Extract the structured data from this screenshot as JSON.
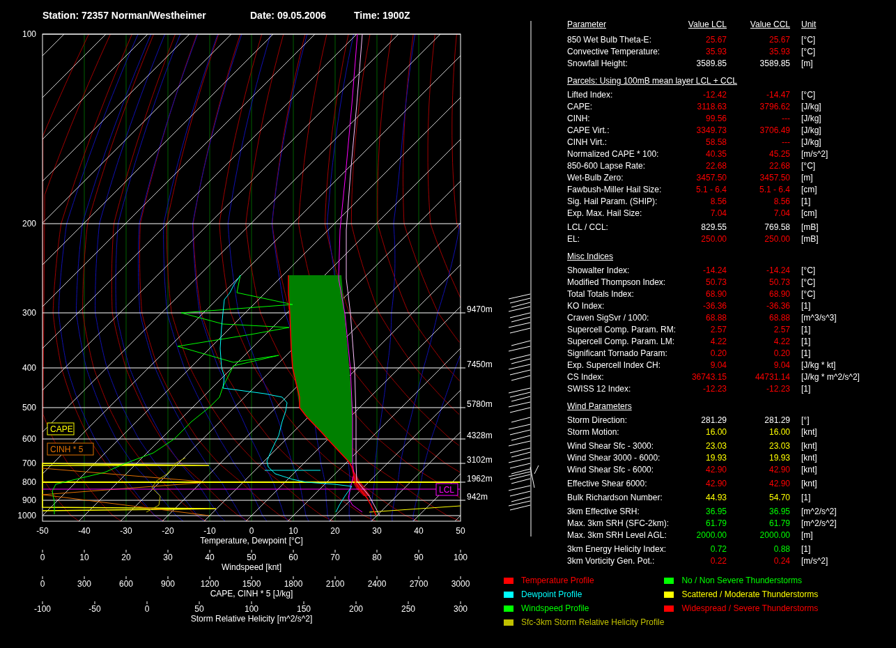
{
  "title": {
    "station": "Station: 72357 Norman/Westheimer",
    "date": "Date: 09.05.2006",
    "time": "Time: 1900Z"
  },
  "diagram": {
    "pressure_levels": [
      {
        "label": "100"
      },
      {
        "label": "200"
      },
      {
        "label": "300",
        "height": "9470m"
      },
      {
        "label": "400",
        "height": "7450m"
      },
      {
        "label": "500",
        "height": "5780m"
      },
      {
        "label": "600",
        "height": "4328m"
      },
      {
        "label": "700",
        "height": "3102m"
      },
      {
        "label": "800",
        "height": "1962m"
      },
      {
        "label": "900",
        "height": "942m"
      },
      {
        "label": "1000"
      }
    ],
    "markers": [
      {
        "kind": "cape",
        "label": "CAPE"
      },
      {
        "kind": "cinh",
        "label": "CINH * 5"
      },
      {
        "kind": "lcl",
        "label": "LCL"
      }
    ],
    "axes": [
      {
        "title": "Temperature, Dewpoint [°C]",
        "ticks": [
          "-50",
          "-40",
          "-30",
          "-20",
          "-10",
          "0",
          "10",
          "20",
          "30",
          "40",
          "50"
        ]
      },
      {
        "title": "Windspeed [knt]",
        "ticks": [
          "0",
          "10",
          "20",
          "30",
          "40",
          "50",
          "60",
          "70",
          "80",
          "90",
          "100"
        ]
      },
      {
        "title": "CAPE, CINH * 5 [J/kg]",
        "ticks": [
          "0",
          "300",
          "600",
          "900",
          "1200",
          "1500",
          "1800",
          "2100",
          "2400",
          "2700",
          "3000"
        ]
      },
      {
        "title": "Storm Relative Helicity [m^2/s^2]",
        "ticks": [
          "-100",
          "-50",
          "0",
          "50",
          "100",
          "150",
          "200",
          "250",
          "300"
        ]
      }
    ]
  },
  "table": {
    "header": [
      "Parameter",
      "Value LCL",
      "Value CCL",
      "Unit"
    ],
    "sections": [
      {
        "groups": [
          [
            {
              "label": "850 Wet Bulb Theta-E:",
              "lcl": "25.67",
              "ccl": "25.67",
              "unit": "[°C]",
              "color": "#ff0000"
            },
            {
              "label": "Convective Temperature:",
              "lcl": "35.93",
              "ccl": "35.93",
              "unit": "[°C]",
              "color": "#ff0000"
            },
            {
              "label": "Snowfall Height:",
              "lcl": "3589.85",
              "ccl": "3589.85",
              "unit": "[m]",
              "color": "#ffffff"
            }
          ]
        ]
      },
      {
        "heading": "Parcels: Using 100mB mean layer LCL + CCL",
        "groups": [
          [
            {
              "label": "Lifted Index:",
              "lcl": "-12.42",
              "ccl": "-14.47",
              "unit": "[°C]",
              "color": "#ff0000"
            },
            {
              "label": "CAPE:",
              "lcl": "3118.63",
              "ccl": "3796.62",
              "unit": "[J/kg]",
              "color": "#ff0000"
            },
            {
              "label": "CINH:",
              "lcl": "99.56",
              "ccl": "---",
              "unit": "[J/kg]",
              "color": "#ff0000"
            },
            {
              "label": "CAPE Virt.:",
              "lcl": "3349.73",
              "ccl": "3706.49",
              "unit": "[J/kg]",
              "color": "#ff0000"
            },
            {
              "label": "CINH Virt.:",
              "lcl": "58.58",
              "ccl": "---",
              "unit": "[J/kg]",
              "color": "#ff0000"
            },
            {
              "label": "Normalized CAPE * 100:",
              "lcl": "40.35",
              "ccl": "45.25",
              "unit": "[m/s^2]",
              "color": "#ff0000"
            },
            {
              "label": "850-600 Lapse Rate:",
              "lcl": "22.68",
              "ccl": "22.68",
              "unit": "[°C]",
              "color": "#ff0000"
            },
            {
              "label": "Wet-Bulb Zero:",
              "lcl": "3457.50",
              "ccl": "3457.50",
              "unit": "[m]",
              "color": "#ff0000"
            },
            {
              "label": "Fawbush-Miller Hail Size:",
              "lcl": "5.1 - 6.4",
              "ccl": "5.1 - 6.4",
              "unit": "[cm]",
              "color": "#ff0000"
            },
            {
              "label": "Sig. Hail Param. (SHIP):",
              "lcl": "8.56",
              "ccl": "8.56",
              "unit": "[1]",
              "color": "#ff0000"
            },
            {
              "label": "Exp. Max. Hail Size:",
              "lcl": "7.04",
              "ccl": "7.04",
              "unit": "[cm]",
              "color": "#ff0000"
            }
          ],
          [
            {
              "label": "LCL / CCL:",
              "lcl": "829.55",
              "ccl": "769.58",
              "unit": "[mB]",
              "color": "#ffffff"
            },
            {
              "label": "EL:",
              "lcl": "250.00",
              "ccl": "250.00",
              "unit": "[mB]",
              "color": "#ff0000"
            }
          ]
        ]
      },
      {
        "heading": "Misc Indices",
        "groups": [
          [
            {
              "label": "Showalter Index:",
              "lcl": "-14.24",
              "ccl": "-14.24",
              "unit": "[°C]",
              "color": "#ff0000"
            },
            {
              "label": "Modified Thompson Index:",
              "lcl": "50.73",
              "ccl": "50.73",
              "unit": "[°C]",
              "color": "#ff0000"
            },
            {
              "label": "Total Totals Index:",
              "lcl": "68.90",
              "ccl": "68.90",
              "unit": "[°C]",
              "color": "#ff0000"
            },
            {
              "label": "KO Index:",
              "lcl": "-36.36",
              "ccl": "-36.36",
              "unit": "[1]",
              "color": "#ff0000"
            },
            {
              "label": "Craven SigSvr / 1000:",
              "lcl": "68.88",
              "ccl": "68.88",
              "unit": "[m^3/s^3]",
              "color": "#ff0000"
            },
            {
              "label": "Supercell Comp. Param. RM:",
              "lcl": "2.57",
              "ccl": "2.57",
              "unit": "[1]",
              "color": "#ff0000"
            },
            {
              "label": "Supercell Comp. Param. LM:",
              "lcl": "4.22",
              "ccl": "4.22",
              "unit": "[1]",
              "color": "#ff0000"
            },
            {
              "label": "Significant Tornado Param:",
              "lcl": "0.20",
              "ccl": "0.20",
              "unit": "[1]",
              "color": "#ff0000"
            },
            {
              "label": "Exp. Supercell Index CH:",
              "lcl": "9.04",
              "ccl": "9.04",
              "unit": "[J/kg * kt]",
              "color": "#ff0000"
            },
            {
              "label": "CS Index:",
              "lcl": "36743.15",
              "ccl": "44731.14",
              "unit": "[J/kg * m^2/s^2]",
              "color": "#ff0000"
            },
            {
              "label": "SWISS 12 Index:",
              "lcl": "-12.23",
              "ccl": "-12.23",
              "unit": "[1]",
              "color": "#ff0000"
            }
          ]
        ]
      },
      {
        "heading": "Wind Parameters",
        "groups": [
          [
            {
              "label": "Storm Direction:",
              "lcl": "281.29",
              "ccl": "281.29",
              "unit": "[°]",
              "color": "#ffffff"
            },
            {
              "label": "Storm Motion:",
              "lcl": "16.00",
              "ccl": "16.00",
              "unit": "[knt]",
              "color": "#ffff00"
            }
          ],
          [
            {
              "label": "Wind Shear Sfc - 3000:",
              "lcl": "23.03",
              "ccl": "23.03",
              "unit": "[knt]",
              "color": "#ffff00"
            },
            {
              "label": "Wind Shear 3000 - 6000:",
              "lcl": "19.93",
              "ccl": "19.93",
              "unit": "[knt]",
              "color": "#ffff00"
            },
            {
              "label": "Wind Shear Sfc - 6000:",
              "lcl": "42.90",
              "ccl": "42.90",
              "unit": "[knt]",
              "color": "#ff0000"
            }
          ],
          [
            {
              "label": "Effective Shear 6000:",
              "lcl": "42.90",
              "ccl": "42.90",
              "unit": "[knt]",
              "color": "#ff0000"
            }
          ],
          [
            {
              "label": "Bulk Richardson Number:",
              "lcl": "44.93",
              "ccl": "54.70",
              "unit": "[1]",
              "color": "#ffff00"
            }
          ],
          [
            {
              "label": "3km Effective SRH:",
              "lcl": "36.95",
              "ccl": "36.95",
              "unit": "[m^2/s^2]",
              "color": "#00ff00"
            },
            {
              "label": "Max. 3km SRH (SFC-2km):",
              "lcl": "61.79",
              "ccl": "61.79",
              "unit": "[m^2/s^2]",
              "color": "#00ff00"
            },
            {
              "label": "Max. 3km SRH Level AGL:",
              "lcl": "2000.00",
              "ccl": "2000.00",
              "unit": "[m]",
              "color": "#00ff00"
            }
          ],
          [
            {
              "label": "3km Energy Helicity Index:",
              "lcl": "0.72",
              "ccl": "0.88",
              "unit": "[1]",
              "color": "#00ff00"
            },
            {
              "label": "3km Vorticity Gen. Pot.:",
              "lcl": "0.22",
              "ccl": "0.24",
              "unit": "[m/s^2]",
              "color": "#ff0000"
            }
          ]
        ]
      }
    ]
  },
  "legend": {
    "profiles": [
      {
        "label": "Temperature Profile",
        "color": "#ff0000"
      },
      {
        "label": "Dewpoint Profile",
        "color": "#00ffff"
      },
      {
        "label": "Windspeed Profile",
        "color": "#00ff00"
      },
      {
        "label": "Sfc-3km Storm Relative Helicity Profile",
        "color": "#c0c000"
      }
    ],
    "severity": [
      {
        "label": "No / Non Severe Thunderstorms",
        "color": "#00ff00"
      },
      {
        "label": "Scattered / Moderate Thunderstorms",
        "color": "#ffff00"
      },
      {
        "label": "Widespread / Severe Thunderstorms",
        "color": "#ff0000"
      }
    ]
  }
}
